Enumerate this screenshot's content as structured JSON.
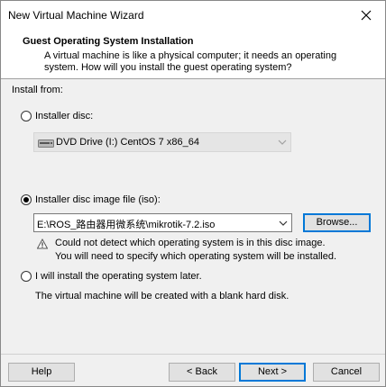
{
  "window": {
    "title": "New Virtual Machine Wizard"
  },
  "header": {
    "heading": "Guest Operating System Installation",
    "description_line1": "A virtual machine is like a physical computer; it needs an operating",
    "description_line2": "system. How will you install the guest operating system?"
  },
  "install_from": {
    "label": "Install from:",
    "options": [
      {
        "label": "Installer disc:",
        "selected": false
      },
      {
        "label": "Installer disc image file (iso):",
        "selected": true
      },
      {
        "label": "I will install the operating system later.",
        "selected": false
      }
    ],
    "disc_drive": {
      "value": "DVD Drive (I:) CentOS 7 x86_64",
      "enabled": false
    },
    "iso_path": {
      "value": "E:\\ROS_路由器用微系统\\mikrotik-7.2.iso"
    },
    "browse_label": "Browse...",
    "warning_line1": "Could not detect which operating system is in this disc image.",
    "warning_line2": "You will need to specify which operating system will be installed.",
    "later_note": "The virtual machine will be created with a blank hard disk."
  },
  "footer": {
    "help_label": "Help",
    "back_label": "< Back",
    "next_label": "Next >",
    "cancel_label": "Cancel"
  },
  "icons": {
    "close": "close-icon",
    "drive": "dvd-drive-icon",
    "warning": "warning-icon",
    "dropdown": "chevron-down-icon"
  }
}
